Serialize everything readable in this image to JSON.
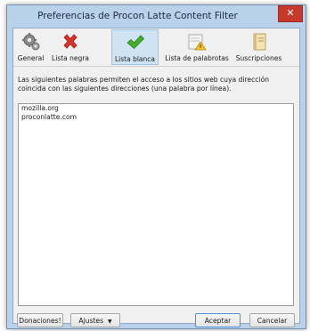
{
  "window": {
    "title": "Preferencias de Procon Latte Content Filter",
    "close_glyph": "✕"
  },
  "tabs": [
    {
      "label": "General",
      "icon": "gears-icon"
    },
    {
      "label": "Lista negra",
      "icon": "red-x-icon"
    },
    {
      "label": "Lista blanca",
      "icon": "green-check-icon",
      "active": true
    },
    {
      "label": "Lista de palabrotas",
      "icon": "warning-note-icon"
    },
    {
      "label": "Suscripciones",
      "icon": "notebook-icon"
    }
  ],
  "whitelist": {
    "description": "Las siguientes palabras permiten el acceso a los sitios web cuya dirección coincida con las siguientes direcciones (una palabra por línea).",
    "entries": [
      "mozilla.org",
      "proconlatte.com"
    ]
  },
  "buttons": {
    "donate": "Donaciones!",
    "settings": "Ajustes",
    "settings_caret": "▼",
    "accept": "Aceptar",
    "cancel": "Cancelar"
  },
  "colors": {
    "titlebar": "#b9d1ea",
    "close": "#c7382d",
    "active_tab": "#cfe3f5",
    "default_button_border": "#4f8fd6"
  }
}
